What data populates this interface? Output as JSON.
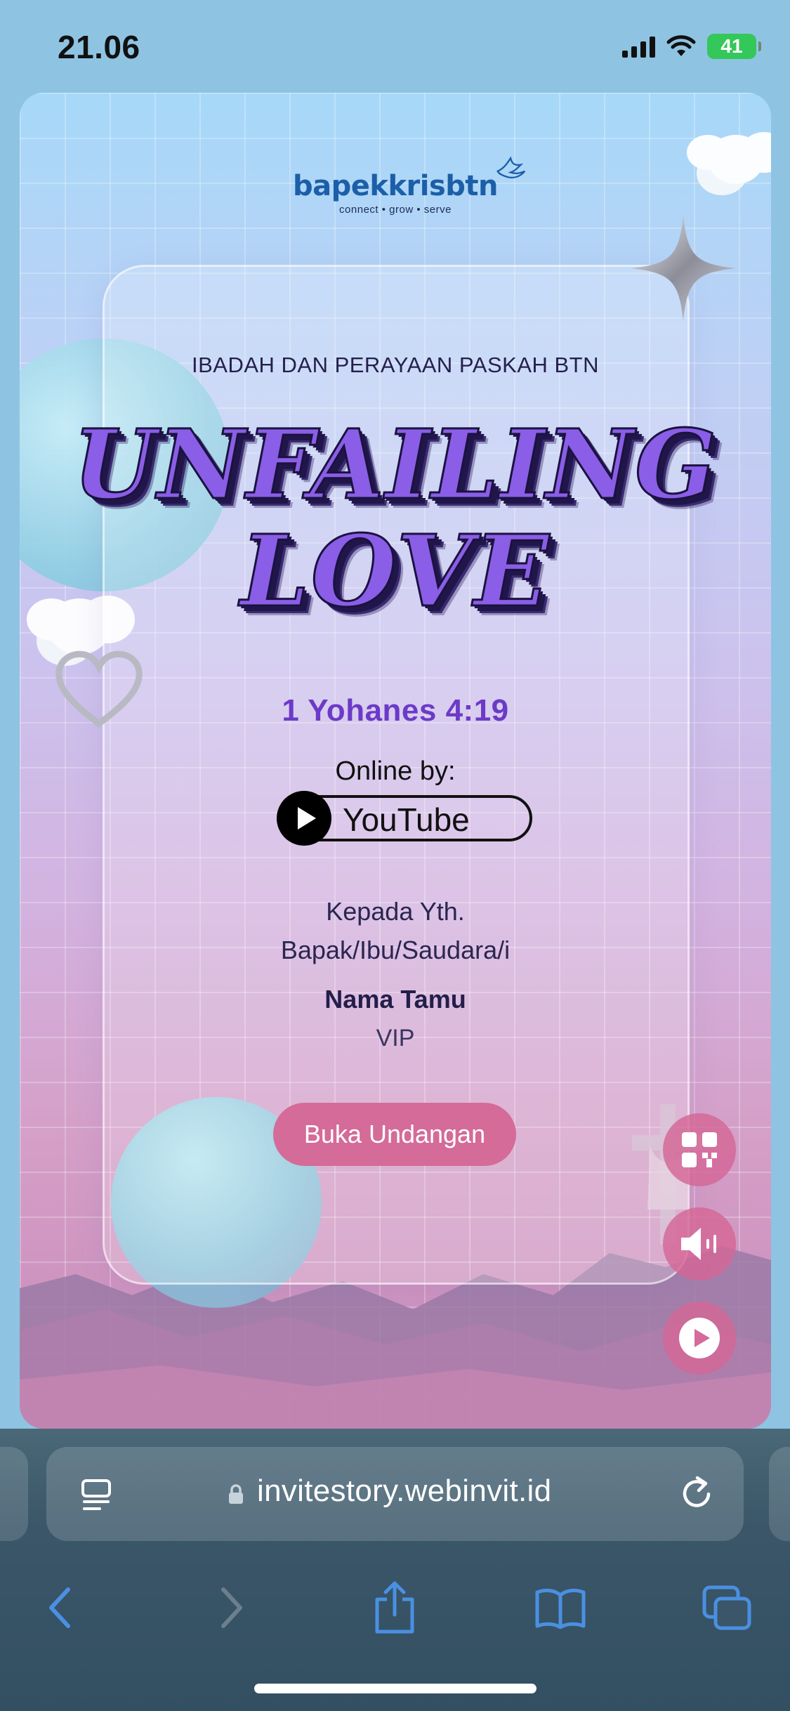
{
  "status_bar": {
    "time": "21.06",
    "battery": "41"
  },
  "invitation": {
    "logo_name": "bapekkrisbtn",
    "logo_tagline": "connect • grow • serve",
    "event_title": "IBADAH DAN PERAYAAN PASKAH BTN",
    "headline_line1": "UNFAILING",
    "headline_line2": "LOVE",
    "verse": "1 Yohanes 4:19",
    "online_label": "Online by:",
    "platform": "YouTube",
    "greeting_line1": "Kepada Yth.",
    "greeting_line2": "Bapak/Ibu/Saudara/i",
    "guest_name": "Nama Tamu",
    "guest_tag": "VIP",
    "open_button": "Buka Undangan"
  },
  "browser": {
    "url": "invitestory.webinvit.id"
  },
  "colors": {
    "accent_pink": "#d46b99",
    "verse_purple": "#6c3ac8",
    "ios_blue": "#4a90e2",
    "battery_green": "#34c759"
  }
}
